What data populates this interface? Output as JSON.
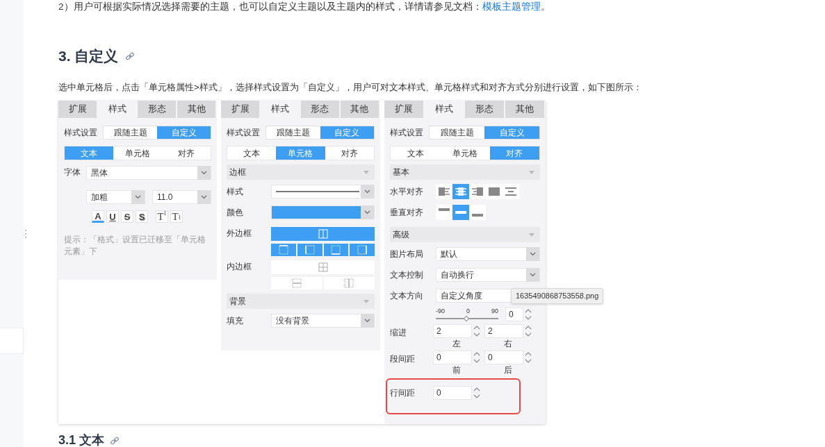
{
  "intro": {
    "text": "2）用户可根据实际情况选择需要的主题，也可以自定义主题以及主题内的样式，详情请参见文档：",
    "link": "模板主题管理",
    "end": "。"
  },
  "heading": "3. 自定义",
  "paragraph": "选中单元格后，点击「单元格属性>样式」，选择样式设置为「自定义」，用户可对文本样式、单元格样式和对齐方式分别进行设置，如下图所示：",
  "panels": [
    {
      "tabs": [
        {
          "label": "扩展",
          "selected": false
        },
        {
          "label": "样式",
          "selected": true
        },
        {
          "label": "形态",
          "selected": false
        },
        {
          "label": "其他",
          "selected": false
        }
      ],
      "style_setting": {
        "label": "样式设置",
        "options": [
          {
            "label": "跟随主题",
            "selected": false
          },
          {
            "label": "自定义",
            "selected": true
          }
        ]
      },
      "subtabs": [
        {
          "label": "文本",
          "selected": true
        },
        {
          "label": "单元格",
          "selected": false
        },
        {
          "label": "对齐",
          "selected": false
        }
      ],
      "rows": [
        {
          "kind": "select",
          "label": "字体",
          "value": "黑体"
        },
        {
          "kind": "select_pair",
          "items": [
            {
              "value": "加粗"
            },
            {
              "value": "11.0"
            }
          ]
        },
        {
          "kind": "format",
          "buttons": [
            {
              "kind": "color",
              "text": "A"
            },
            {
              "kind": "underline",
              "text": "U"
            },
            {
              "kind": "strike",
              "text": "S"
            },
            {
              "kind": "shadow",
              "text": "S"
            },
            {
              "kind": "sup",
              "text": "T$^{1}$"
            },
            {
              "kind": "sub",
              "text": "T$_{1}$"
            }
          ]
        },
        {
          "kind": "hint",
          "text": "提示：「格式」设置已迁移至「单元格元素」下"
        }
      ]
    },
    {
      "tabs": [
        {
          "label": "扩展",
          "selected": false
        },
        {
          "label": "样式",
          "selected": true
        },
        {
          "label": "形态",
          "selected": false
        },
        {
          "label": "其他",
          "selected": false
        }
      ],
      "style_setting": {
        "label": "样式设置",
        "options": [
          {
            "label": "跟随主题",
            "selected": false
          },
          {
            "label": "自定义",
            "selected": true
          }
        ]
      },
      "subtabs": [
        {
          "label": "文本",
          "selected": false
        },
        {
          "label": "单元格",
          "selected": true
        },
        {
          "label": "对齐",
          "selected": false
        }
      ],
      "rows": [
        {
          "kind": "section",
          "label": "边框"
        },
        {
          "kind": "line_select",
          "label": "样式"
        },
        {
          "kind": "color_select",
          "label": "颜色",
          "color": "#3d9ef2"
        },
        {
          "kind": "outer_border",
          "label": "外边框"
        },
        {
          "kind": "inner_border",
          "label": "内边框"
        },
        {
          "kind": "section",
          "label": "背景"
        },
        {
          "kind": "select",
          "label": "填充",
          "value": "没有背景"
        }
      ]
    },
    {
      "tabs": [
        {
          "label": "扩展",
          "selected": false
        },
        {
          "label": "样式",
          "selected": true
        },
        {
          "label": "形态",
          "selected": false
        },
        {
          "label": "其他",
          "selected": false
        }
      ],
      "style_setting": {
        "label": "样式设置",
        "options": [
          {
            "label": "跟随主题",
            "selected": false
          },
          {
            "label": "自定义",
            "selected": true
          }
        ]
      },
      "subtabs": [
        {
          "label": "文本",
          "selected": false
        },
        {
          "label": "单元格",
          "selected": false
        },
        {
          "label": "对齐",
          "selected": true
        }
      ],
      "rows": [
        {
          "kind": "section",
          "label": "基本"
        },
        {
          "kind": "h_align",
          "label": "水平对齐",
          "options": [
            {
              "selected": false
            },
            {
              "selected": true
            },
            {
              "selected": false
            },
            {
              "selected": false
            },
            {
              "selected": false
            }
          ]
        },
        {
          "kind": "v_align",
          "label": "垂直对齐",
          "options": [
            {
              "selected": false
            },
            {
              "selected": true
            },
            {
              "selected": false
            }
          ]
        },
        {
          "kind": "section",
          "label": "高级"
        },
        {
          "kind": "select",
          "label": "图片布局",
          "value": "默认"
        },
        {
          "kind": "select",
          "label": "文本控制",
          "value": "自动换行"
        },
        {
          "kind": "select",
          "label": "文本方向",
          "value": "自定义角度"
        },
        {
          "kind": "angle",
          "ticks": [
            "-90",
            "0",
            "90"
          ],
          "level": 0.5,
          "value": "0"
        },
        {
          "kind": "spin_pair",
          "label": "缩进",
          "items": [
            {
              "value": "2",
              "caption": "左"
            },
            {
              "value": "2",
              "caption": "右"
            }
          ]
        },
        {
          "kind": "spin_pair",
          "label": "段间距",
          "items": [
            {
              "value": "0",
              "caption": "前"
            },
            {
              "value": "0",
              "caption": "后"
            }
          ]
        },
        {
          "kind": "spin",
          "label": "行间距",
          "value": "0",
          "highlighted": true
        }
      ]
    }
  ],
  "tooltip": "1635490868753558.png",
  "next_heading": "3.1 文本"
}
